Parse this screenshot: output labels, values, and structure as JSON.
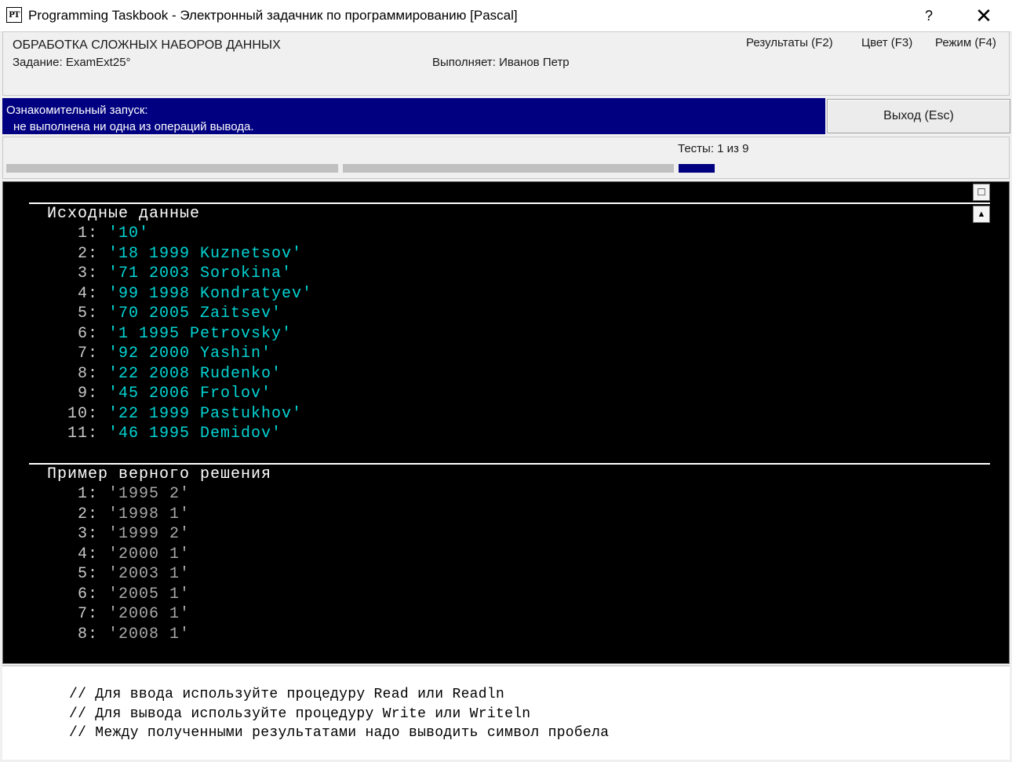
{
  "window": {
    "icon_text": "PT",
    "title": "Programming Taskbook - Электронный задачник по программированию [Pascal]",
    "help_label": "?",
    "close_label": "✕"
  },
  "header": {
    "section_title": "ОБРАБОТКА СЛОЖНЫХ НАБОРОВ ДАННЫХ",
    "task": "Задание: ExamExt25°",
    "performer": "Выполняет: Иванов Петр",
    "menu": {
      "results": "Результаты (F2)",
      "color": "Цвет (F3)",
      "mode": "Режим (F4)"
    }
  },
  "status": {
    "line1": "Ознакомительный запуск:",
    "line2": "не выполнена ни одна из операций вывода.",
    "exit_label": "Выход (Esc)"
  },
  "tests": {
    "label": "Тесты:  1 из 9",
    "current": 1,
    "total": 9,
    "colors": {
      "inactive": "#c0c0c0",
      "active": "#000080"
    }
  },
  "console": {
    "input_heading": "Исходные данные",
    "input_items": [
      {
        "num": " 1:",
        "value": "'10'"
      },
      {
        "num": " 2:",
        "value": "'18 1999 Kuznetsov'"
      },
      {
        "num": " 3:",
        "value": "'71 2003 Sorokina'"
      },
      {
        "num": " 4:",
        "value": "'99 1998 Kondratyev'"
      },
      {
        "num": " 5:",
        "value": "'70 2005 Zaitsev'"
      },
      {
        "num": " 6:",
        "value": "'1 1995 Petrovsky'"
      },
      {
        "num": " 7:",
        "value": "'92 2000 Yashin'"
      },
      {
        "num": " 8:",
        "value": "'22 2008 Rudenko'"
      },
      {
        "num": " 9:",
        "value": "'45 2006 Frolov'"
      },
      {
        "num": "10:",
        "value": "'22 1999 Pastukhov'"
      },
      {
        "num": "11:",
        "value": "'46 1995 Demidov'"
      }
    ],
    "example_heading": "Пример верного решения",
    "example_items": [
      {
        "num": " 1:",
        "value": "'1995 2'"
      },
      {
        "num": " 2:",
        "value": "'1998 1'"
      },
      {
        "num": " 3:",
        "value": "'1999 2'"
      },
      {
        "num": " 4:",
        "value": "'2000 1'"
      },
      {
        "num": " 5:",
        "value": "'2003 1'"
      },
      {
        "num": " 6:",
        "value": "'2005 1'"
      },
      {
        "num": " 7:",
        "value": "'2006 1'"
      },
      {
        "num": " 8:",
        "value": "'2008 1'"
      }
    ],
    "btn_square": "□",
    "btn_up": "▲"
  },
  "comments": [
    "// Для ввода используйте процедуру Read или Readln",
    "// Для вывода используйте процедуру Write или Writeln",
    "// Между полученными результатами надо выводить символ пробела"
  ]
}
